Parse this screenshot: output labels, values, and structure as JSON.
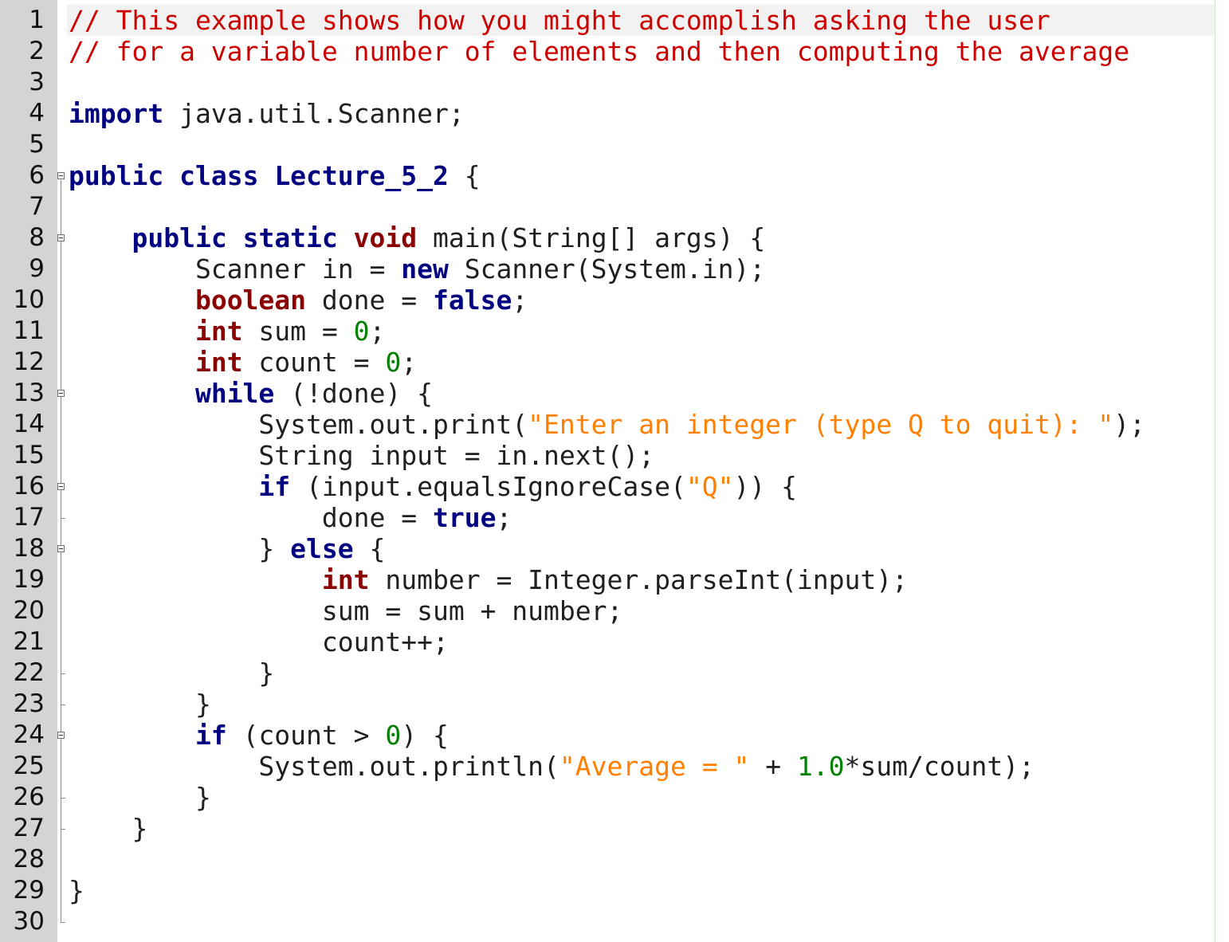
{
  "editor": {
    "line_numbers": [
      "1",
      "2",
      "3",
      "4",
      "5",
      "6",
      "7",
      "8",
      "9",
      "10",
      "11",
      "12",
      "13",
      "14",
      "15",
      "16",
      "17",
      "18",
      "19",
      "20",
      "21",
      "22",
      "23",
      "24",
      "25",
      "26",
      "27",
      "28",
      "29",
      "30"
    ],
    "lines": [
      [
        {
          "t": "// This example shows how you might accomplish asking the user",
          "c": "cm"
        }
      ],
      [
        {
          "t": "// for a variable number of elements and then computing the average",
          "c": "cm"
        }
      ],
      [],
      [
        {
          "t": "import",
          "c": "kw"
        },
        {
          "t": " java.util.Scanner;",
          "c": "pl"
        }
      ],
      [],
      [
        {
          "t": "public",
          "c": "kw"
        },
        {
          "t": " ",
          "c": "pl"
        },
        {
          "t": "class",
          "c": "kw"
        },
        {
          "t": " ",
          "c": "pl"
        },
        {
          "t": "Lecture_5_2",
          "c": "cls"
        },
        {
          "t": " {",
          "c": "pl"
        }
      ],
      [],
      [
        {
          "t": "    ",
          "c": "pl"
        },
        {
          "t": "public",
          "c": "kw"
        },
        {
          "t": " ",
          "c": "pl"
        },
        {
          "t": "static",
          "c": "kw"
        },
        {
          "t": " ",
          "c": "pl"
        },
        {
          "t": "void",
          "c": "ty"
        },
        {
          "t": " main(String[] args) {",
          "c": "pl"
        }
      ],
      [
        {
          "t": "        Scanner in = ",
          "c": "pl"
        },
        {
          "t": "new",
          "c": "kw"
        },
        {
          "t": " Scanner(System.in);",
          "c": "pl"
        }
      ],
      [
        {
          "t": "        ",
          "c": "pl"
        },
        {
          "t": "boolean",
          "c": "ty"
        },
        {
          "t": " done = ",
          "c": "pl"
        },
        {
          "t": "false",
          "c": "kw"
        },
        {
          "t": ";",
          "c": "pl"
        }
      ],
      [
        {
          "t": "        ",
          "c": "pl"
        },
        {
          "t": "int",
          "c": "ty"
        },
        {
          "t": " sum = ",
          "c": "pl"
        },
        {
          "t": "0",
          "c": "num"
        },
        {
          "t": ";",
          "c": "pl"
        }
      ],
      [
        {
          "t": "        ",
          "c": "pl"
        },
        {
          "t": "int",
          "c": "ty"
        },
        {
          "t": " count = ",
          "c": "pl"
        },
        {
          "t": "0",
          "c": "num"
        },
        {
          "t": ";",
          "c": "pl"
        }
      ],
      [
        {
          "t": "        ",
          "c": "pl"
        },
        {
          "t": "while",
          "c": "kw"
        },
        {
          "t": " (!done) {",
          "c": "pl"
        }
      ],
      [
        {
          "t": "            System.out.print(",
          "c": "pl"
        },
        {
          "t": "\"Enter an integer (type Q to quit): \"",
          "c": "str"
        },
        {
          "t": ");",
          "c": "pl"
        }
      ],
      [
        {
          "t": "            String input = in.next();",
          "c": "pl"
        }
      ],
      [
        {
          "t": "            ",
          "c": "pl"
        },
        {
          "t": "if",
          "c": "kw"
        },
        {
          "t": " (input.equalsIgnoreCase(",
          "c": "pl"
        },
        {
          "t": "\"Q\"",
          "c": "str"
        },
        {
          "t": ")) {",
          "c": "pl"
        }
      ],
      [
        {
          "t": "                done = ",
          "c": "pl"
        },
        {
          "t": "true",
          "c": "kw"
        },
        {
          "t": ";",
          "c": "pl"
        }
      ],
      [
        {
          "t": "            } ",
          "c": "pl"
        },
        {
          "t": "else",
          "c": "kw"
        },
        {
          "t": " {",
          "c": "pl"
        }
      ],
      [
        {
          "t": "                ",
          "c": "pl"
        },
        {
          "t": "int",
          "c": "ty"
        },
        {
          "t": " number = Integer.parseInt(input);",
          "c": "pl"
        }
      ],
      [
        {
          "t": "                sum = sum + number;",
          "c": "pl"
        }
      ],
      [
        {
          "t": "                count++;",
          "c": "pl"
        }
      ],
      [
        {
          "t": "            }",
          "c": "pl"
        }
      ],
      [
        {
          "t": "        }",
          "c": "pl"
        }
      ],
      [
        {
          "t": "        ",
          "c": "pl"
        },
        {
          "t": "if",
          "c": "kw"
        },
        {
          "t": " (count > ",
          "c": "pl"
        },
        {
          "t": "0",
          "c": "num"
        },
        {
          "t": ") {",
          "c": "pl"
        }
      ],
      [
        {
          "t": "            System.out.println(",
          "c": "pl"
        },
        {
          "t": "\"Average = \"",
          "c": "str"
        },
        {
          "t": " + ",
          "c": "pl"
        },
        {
          "t": "1.0",
          "c": "num"
        },
        {
          "t": "*sum/count);",
          "c": "pl"
        }
      ],
      [
        {
          "t": "        }",
          "c": "pl"
        }
      ],
      [
        {
          "t": "    }",
          "c": "pl"
        }
      ],
      [],
      [
        {
          "t": "}",
          "c": "pl"
        }
      ],
      []
    ]
  },
  "colors": {
    "comment": "#cc0000",
    "keyword": "#000080",
    "type": "#8b0000",
    "number": "#008000",
    "string": "#ff8000",
    "gutter": "#d4d4d4"
  }
}
